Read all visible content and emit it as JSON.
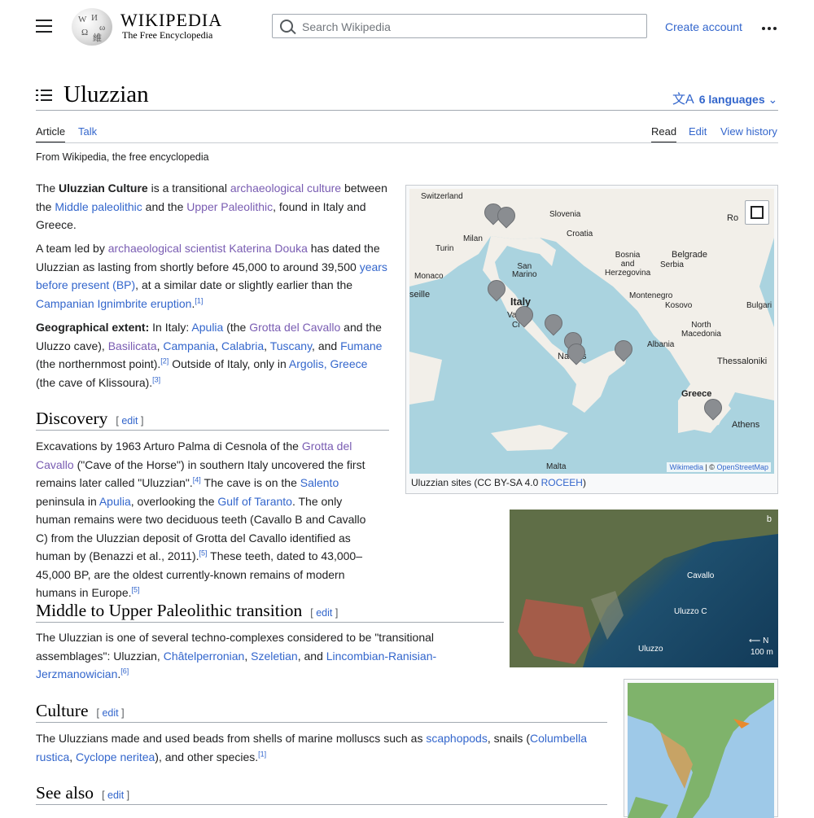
{
  "header": {
    "wordmark": "WIKIPEDIA",
    "tagline": "The Free Encyclopedia",
    "search_placeholder": "Search Wikipedia",
    "create_account": "Create account"
  },
  "title": {
    "text": "Uluzzian",
    "languages": "6 languages"
  },
  "tabs": {
    "article": "Article",
    "talk": "Talk",
    "read": "Read",
    "edit": "Edit",
    "view_history": "View history"
  },
  "from": "From Wikipedia, the free encyclopedia",
  "intro": {
    "p1": {
      "t1": "The ",
      "bold": "Uluzzian Culture",
      "t2": " is a transitional ",
      "l1": "archaeological culture",
      "t3": " between the ",
      "l2": "Middle paleolithic",
      "t4": " and the ",
      "l3": "Upper Paleolithic",
      "t5": ", found in Italy and Greece."
    },
    "p2": {
      "t1": "A team led by ",
      "l1": "archaeological scientist",
      "t2": " ",
      "l2": "Katerina Douka",
      "t3": " has dated the Uluzzian as lasting from shortly before 45,000 to around 39,500 ",
      "l3": "years before present (BP)",
      "t4": ", at a similar date or slightly earlier than the ",
      "l4": "Campanian Ignimbrite eruption",
      "t5": ".",
      "ref": "[1]"
    },
    "p3": {
      "bold": "Geographical extent:",
      "t1": " In Italy: ",
      "l1": "Apulia",
      "t2": " (the ",
      "l2": "Grotta del Cavallo",
      "t3": " and the Uluzzo cave), ",
      "l3": "Basilicata",
      "t4": ", ",
      "l4": "Campania",
      "t5": ", ",
      "l5": "Calabria",
      "t6": ", ",
      "l6": "Tuscany",
      "t7": ", and ",
      "l7": "Fumane",
      "t8": " (the northernmost point).",
      "ref1": "[2]",
      "t9": " Outside of Italy, only in ",
      "l8": "Argolis, Greece",
      "t10": " (the cave of Klissoura).",
      "ref2": "[3]"
    }
  },
  "sections": {
    "edit_label": "edit",
    "discovery": {
      "heading": "Discovery",
      "t1": "Excavations by 1963 Arturo Palma di Cesnola of the ",
      "l1": "Grotta del Cavallo",
      "t2": " (\"Cave of the Horse\") in southern Italy uncovered the first remains later called \"Uluzzian\".",
      "ref1": "[4]",
      "t3": " The cave is on the ",
      "l2": "Salento",
      "t4": " peninsula in ",
      "l3": "Apulia",
      "t5": ", overlooking the ",
      "l4": "Gulf of Taranto",
      "t6": ". The only human remains were two deciduous teeth (Cavallo B and Cavallo C) from the Uluzzian deposit of Grotta del Cavallo identified as human by (Benazzi et al., 2011).",
      "ref2": "[5]",
      "t7": " These teeth, dated to 43,000–45,000 BP, are the oldest currently-known remains of modern humans in Europe.",
      "ref3": "[5]"
    },
    "transition": {
      "heading": "Middle to Upper Paleolithic transition",
      "t1": "The Uluzzian is one of several techno-complexes considered to be \"transitional assemblages\": Uluzzian, ",
      "l1": "Châtelperronian",
      "t2": ", ",
      "l2": "Szeletian",
      "t3": ", and ",
      "l3": "Lincombian-Ranisian-Jerzmanowician",
      "t4": ".",
      "ref": "[6]"
    },
    "culture": {
      "heading": "Culture",
      "t1": "The Uluzzians made and used beads from shells of marine molluscs such as ",
      "l1": "scaphopods",
      "t2": ", snails (",
      "l2": "Columbella rustica",
      "t3": ", ",
      "l3": "Cyclope neritea",
      "t4": "), and other species.",
      "ref": "[1]"
    },
    "see_also": {
      "heading": "See also"
    }
  },
  "map": {
    "labels": {
      "switzerland": "Switzerland",
      "slovenia": "Slovenia",
      "croatia": "Croatia",
      "milan": "Milan",
      "turin": "Turin",
      "bosnia": "Bosnia\nand\nHerzegovina",
      "serbia": "Serbia",
      "belgrade": "Belgrade",
      "san_marino": "San\nMarino",
      "monaco": "Monaco",
      "marseille": "seille",
      "montenegro": "Montenegro",
      "kosovo": "Kosovo",
      "italy": "Italy",
      "vatican": "Va",
      "rome_city": "Ci",
      "bulgaria": "Bulgari",
      "north_macedonia": "North\nMacedonia",
      "albania": "Albania",
      "naples": "Na",
      "naples_end": "s",
      "thessaloniki": "Thessaloniki",
      "greece": "Greece",
      "athens": "Athens",
      "malta": "Malta",
      "romania": "Ro"
    },
    "attribution_wikimedia": "Wikimedia",
    "attribution_osm": "OpenStreetMap",
    "caption_text": "Uluzzian sites (CC BY-SA 4.0 ",
    "caption_link": "ROCEEH",
    "caption_end": ")"
  },
  "photo": {
    "corner": "b",
    "cavallo": "Cavallo",
    "uluzzo_c": "Uluzzo C",
    "uluzzo": "Uluzzo",
    "north": "N",
    "scale": "100 m"
  }
}
